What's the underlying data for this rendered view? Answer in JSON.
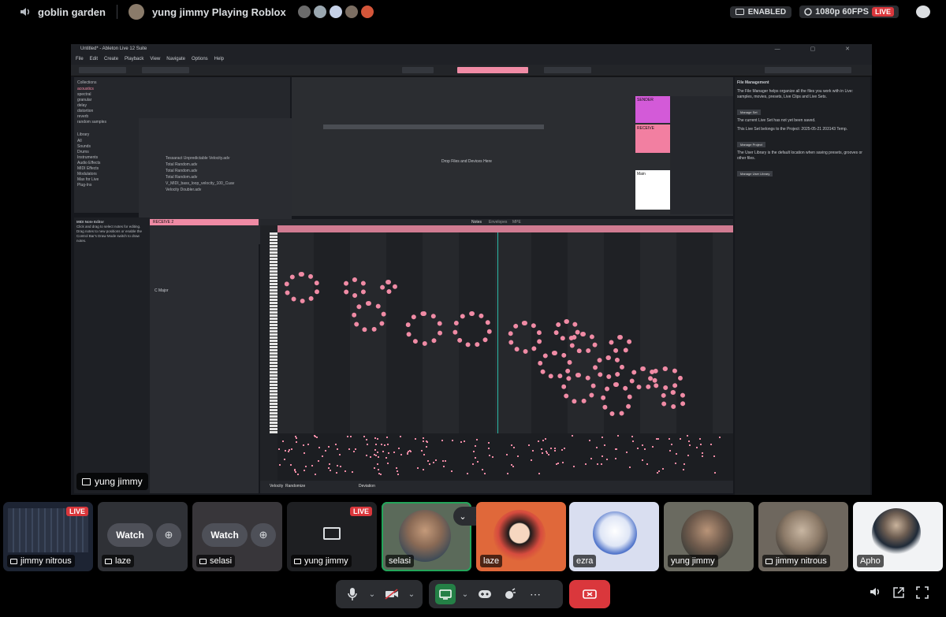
{
  "topbar": {
    "channel": "goblin garden",
    "stream_title": "yung jimmy Playing Roblox",
    "enabled_label": "ENABLED",
    "quality_label": "1080p 60FPS",
    "live_label": "LIVE"
  },
  "stream": {
    "window_title": "Untitled* - Ableton Live 12 Suite",
    "menu": [
      "File",
      "Edit",
      "Create",
      "Playback",
      "View",
      "Navigate",
      "Options",
      "Help"
    ],
    "browser_categories": [
      "Collections",
      "acoustics",
      "spectral",
      "granular",
      "delay",
      "distortion",
      "reverb",
      "random samples"
    ],
    "browser_library": [
      "Library",
      "All",
      "Sounds",
      "Drums",
      "Instruments",
      "Audio Effects",
      "MIDI Effects",
      "Modulators",
      "Max for Live",
      "Plug-Ins"
    ],
    "browser_results": [
      "Tessaract Unpredictable Velocity.adv",
      "Total Random.adv",
      "Total Random.adv",
      "Total Random.adv",
      "V_MIDI_bass_loop_velocity_100_Cuav",
      "Velocity Doubler.adv"
    ],
    "drop_label": "Drop Files and Devices Here",
    "tracks": [
      "SENDER",
      "RECEIVE",
      "Main"
    ],
    "info_title": "File Management",
    "info_p1": "The File Manager helps organize all the files you work with in Live: samples, movies, presets, Live Clips and Live Sets.",
    "info_btn1": "Manage Set",
    "info_p2": "The current Live Set has not yet been saved.",
    "info_p3": "This Live Set belongs to the Project: 2025-05-21 203143 Temp.",
    "info_btn2": "Manage Project",
    "info_p4": "The User Library is the default location when saving presets, grooves or other files.",
    "info_btn3": "Manage User Library",
    "clip_help_title": "MIDI Note Editor",
    "clip_help": "Click and drag to select notes for editing. Drag notes to new positions or enable the Control Bar's Draw Mode switch to draw notes.",
    "clip_name": "RECEIVE 2",
    "scale_value": "C  Major",
    "piano_tabs": [
      "Notes",
      "Envelopes",
      "MPE"
    ],
    "velocity_label": "Velocity",
    "randomize_label": "Randomize",
    "deviation_label": "Deviation",
    "presenter": "yung jimmy"
  },
  "tiles": [
    {
      "name": "jimmy nitrous",
      "live": "LIVE"
    },
    {
      "name": "laze",
      "watch": "Watch"
    },
    {
      "name": "selasi",
      "watch": "Watch"
    },
    {
      "name": "yung jimmy",
      "live": "LIVE"
    },
    {
      "name": "selasi"
    },
    {
      "name": "laze"
    },
    {
      "name": "ezra"
    },
    {
      "name": "yung jimmy"
    },
    {
      "name": "jimmy nitrous"
    },
    {
      "name": "Apho"
    }
  ],
  "colors": {
    "accent_pink": "#f08ba5",
    "live_red": "#da373c",
    "speaking_green": "#23a55a",
    "stream_bg": "#16181d"
  },
  "icons": [
    "speaker-icon",
    "chat-icon",
    "mic-icon",
    "camera-off-icon",
    "screen-share-icon",
    "activity-icon",
    "soundboard-icon",
    "more-icon",
    "hangup-icon",
    "volume-icon",
    "popout-icon",
    "fullscreen-icon"
  ]
}
